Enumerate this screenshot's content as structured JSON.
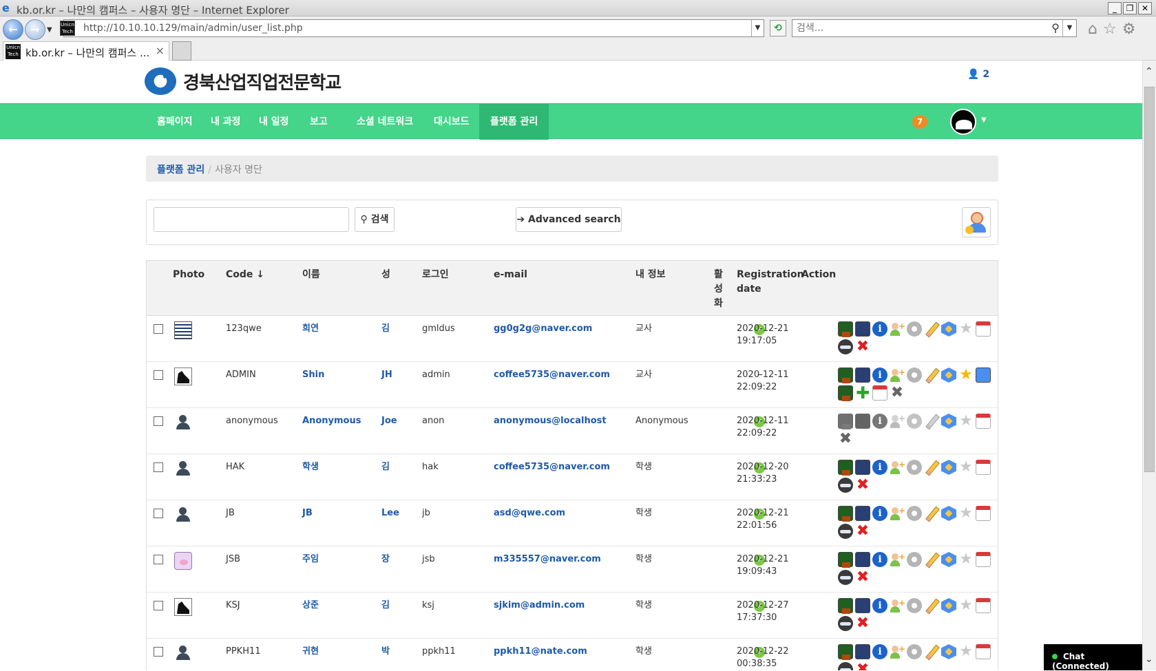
{
  "browser": {
    "window_title": "kb.or.kr – 나만의 캠퍼스 – 사용자 명단 – Internet Explorer",
    "url": "http://10.10.10.129/main/admin/user_list.php",
    "search_placeholder": "검색...",
    "tab_title": "kb.or.kr – 나만의 캠퍼스 ...",
    "tab_close": "×"
  },
  "site": {
    "logo_text": "경북산업직업전문학교",
    "online_count": "2",
    "notification_count": "7"
  },
  "nav": {
    "items": [
      "홈페이지",
      "내 과정",
      "내 일정",
      "보고",
      "소셜 네트워크",
      "대시보드",
      "플랫폼 관리"
    ],
    "active": "플랫폼 관리"
  },
  "breadcrumb": {
    "parent": "플랫폼 관리",
    "current": "사용자 명단"
  },
  "search": {
    "button": "검색",
    "advanced": "Advanced search"
  },
  "table": {
    "headers": {
      "photo": "Photo",
      "code": "Code ↓",
      "first_name": "이름",
      "last_name": "성",
      "login": "로그인",
      "email": "e-mail",
      "profile": "내 정보",
      "active_l1": "활",
      "active_l2": "성",
      "active_l3": "화",
      "reg_l1": "Registration",
      "reg_l2": "date",
      "action": "Action"
    },
    "rows": [
      {
        "code": "123qwe",
        "first": "희연",
        "last": "김",
        "login": "gmldus",
        "email": "gg0g2g@naver.com",
        "profile": "교사",
        "active": "✓",
        "date": "2020-12-21",
        "time": "19:17:05"
      },
      {
        "code": "ADMIN",
        "first": "Shin",
        "last": "JH",
        "login": "admin",
        "email": "coffee5735@naver.com",
        "profile": "교사",
        "active": "-",
        "date": "2020-12-11",
        "time": "22:09:22"
      },
      {
        "code": "anonymous",
        "first": "Anonymous",
        "last": "Joe",
        "login": "anon",
        "email": "anonymous@localhost",
        "profile": "Anonymous",
        "active": "✓",
        "date": "2020-12-11",
        "time": "22:09:22"
      },
      {
        "code": "HAK",
        "first": "학생",
        "last": "김",
        "login": "hak",
        "email": "coffee5735@naver.com",
        "profile": "학생",
        "active": "✓",
        "date": "2020-12-20",
        "time": "21:33:23"
      },
      {
        "code": "JB",
        "first": "JB",
        "last": "Lee",
        "login": "jb",
        "email": "asd@qwe.com",
        "profile": "학생",
        "active": "✓",
        "date": "2020-12-21",
        "time": "22:01:56"
      },
      {
        "code": "JSB",
        "first": "주임",
        "last": "장",
        "login": "jsb",
        "email": "m335557@naver.com",
        "profile": "학생",
        "active": "✓",
        "date": "2020-12-21",
        "time": "19:09:43"
      },
      {
        "code": "KSJ",
        "first": "상준",
        "last": "김",
        "login": "ksj",
        "email": "sjkim@admin.com",
        "profile": "학생",
        "active": "✓",
        "date": "2020-12-27",
        "time": "17:37:30"
      },
      {
        "code": "PPKH11",
        "first": "귀현",
        "last": "박",
        "login": "ppkh11",
        "email": "ppkh11@nate.com",
        "profile": "학생",
        "active": "✓",
        "date": "2020-12-22",
        "time": "00:38:35"
      }
    ]
  },
  "chat": {
    "label": "Chat (Connected)"
  }
}
